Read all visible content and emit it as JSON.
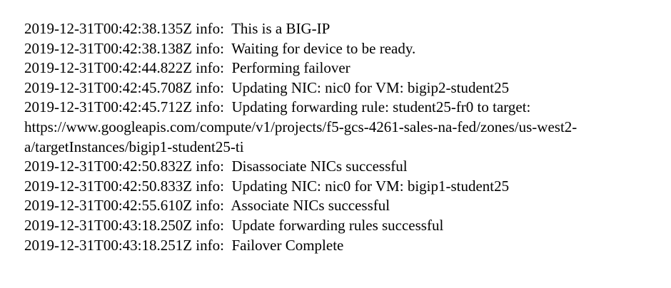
{
  "log": {
    "lines": [
      "2019-12-31T00:42:38.135Z info:  This is a BIG-IP",
      "2019-12-31T00:42:38.138Z info:  Waiting for device to be ready.",
      "2019-12-31T00:42:44.822Z info:  Performing failover",
      "2019-12-31T00:42:45.708Z info:  Updating NIC: nic0 for VM: bigip2-student25",
      "2019-12-31T00:42:45.712Z info:  Updating forwarding rule: student25-fr0 to target:",
      "https://www.googleapis.com/compute/v1/projects/f5-gcs-4261-sales-na-fed/zones/us-west2-",
      "a/targetInstances/bigip1-student25-ti",
      "2019-12-31T00:42:50.832Z info:  Disassociate NICs successful",
      "2019-12-31T00:42:50.833Z info:  Updating NIC: nic0 for VM: bigip1-student25",
      "2019-12-31T00:42:55.610Z info:  Associate NICs successful",
      "2019-12-31T00:43:18.250Z info:  Update forwarding rules successful",
      "2019-12-31T00:43:18.251Z info:  Failover Complete"
    ]
  }
}
